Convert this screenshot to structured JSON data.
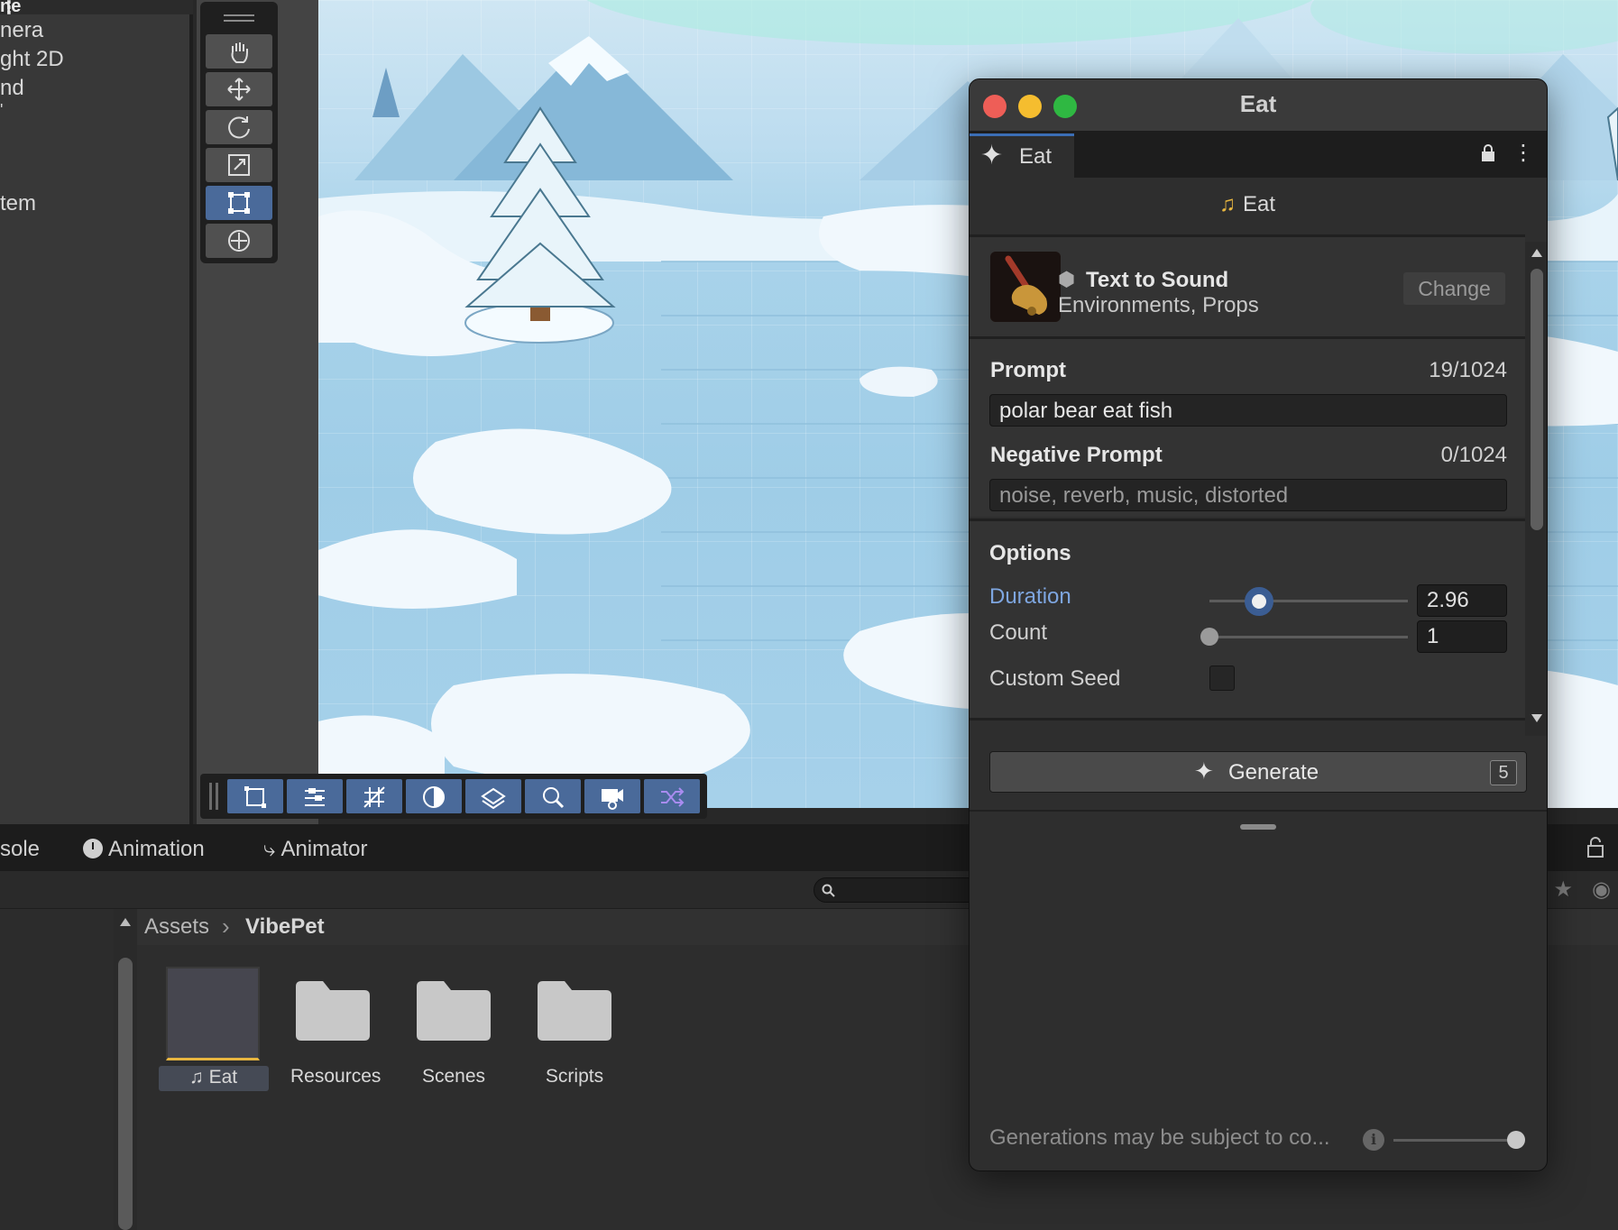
{
  "hierarchy": {
    "title": "ne",
    "items": [
      "nera",
      "ght 2D",
      "nd",
      "'",
      "tem"
    ]
  },
  "scene": {
    "tools": [
      "hand-tool",
      "move-tool",
      "rotate-tool",
      "scale-tool",
      "rect-tool",
      "transform-tool"
    ],
    "active_tool": "rect-tool",
    "toolbar_buttons": [
      "rect-overlay",
      "sliders",
      "grid-snapping",
      "shading-mode",
      "layers",
      "search",
      "camera",
      "random"
    ]
  },
  "bottom_panel": {
    "tabs": [
      "sole",
      "Animation",
      "Animator"
    ],
    "breadcrumb": {
      "root": "Assets",
      "current": "VibePet"
    },
    "assets": [
      {
        "label": "Eat",
        "type": "audio",
        "selected": true
      },
      {
        "label": "Resources",
        "type": "folder"
      },
      {
        "label": "Scenes",
        "type": "folder"
      },
      {
        "label": "Scripts",
        "type": "folder"
      }
    ]
  },
  "window": {
    "title": "Eat",
    "tab_label": "Eat",
    "asset_name": "Eat",
    "model": {
      "name": "Text to Sound",
      "tags": "Environments, Props",
      "change_label": "Change"
    },
    "prompt": {
      "label": "Prompt",
      "count": "19/1024",
      "value": "polar bear eat fish"
    },
    "negative_prompt": {
      "label": "Negative Prompt",
      "count": "0/1024",
      "placeholder": "noise, reverb, music, distorted"
    },
    "options": {
      "label": "Options",
      "duration": {
        "label": "Duration",
        "value": "2.96",
        "slider_fraction": 0.25
      },
      "count": {
        "label": "Count",
        "value": "1",
        "slider_fraction": 0.0
      },
      "custom_seed": {
        "label": "Custom Seed",
        "checked": false
      }
    },
    "generate": {
      "label": "Generate",
      "badge": "5"
    },
    "footer": {
      "text": "Generations may be subject to co...",
      "slider_fraction": 1.0
    }
  },
  "colors": {
    "accent": "#3b6db5",
    "active_label": "#7ea6e0",
    "music_icon": "#e8b640"
  }
}
